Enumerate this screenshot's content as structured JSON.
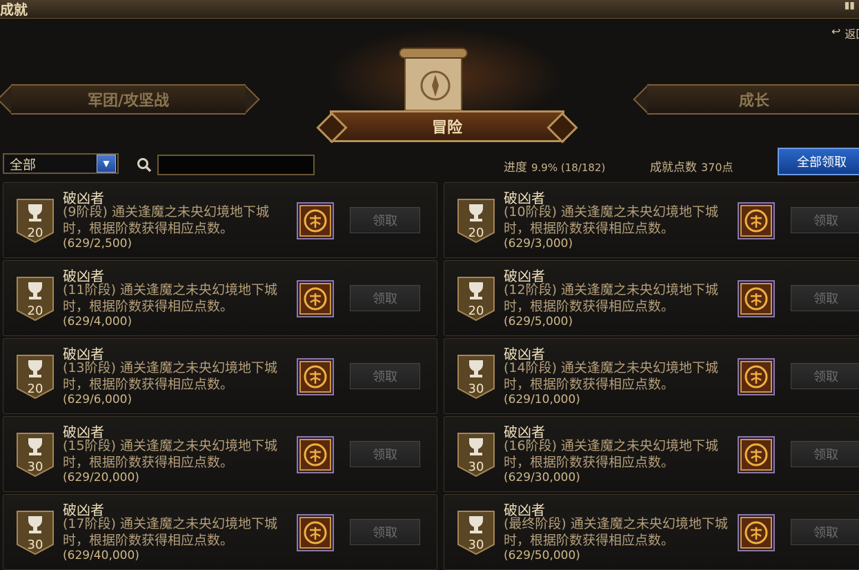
{
  "window": {
    "title": "成就"
  },
  "header": {
    "return_label": "返回"
  },
  "categories": {
    "left": "军团/攻坚战",
    "active": "冒险",
    "right": "成长"
  },
  "filter": {
    "selected": "全部",
    "search_placeholder": ""
  },
  "stats": {
    "progress_label": "进度",
    "progress_value": "9.9% (18/182)",
    "points_label": "成就点数",
    "points_value": "370点"
  },
  "claim_all_label": "全部领取",
  "colors": {
    "accent_blue": "#1f4fa8",
    "gold": "#b89258",
    "bg": "#141210"
  },
  "achievements": [
    {
      "title": "破凶者",
      "points": "20",
      "desc": "(9阶段) 通关逢魔之未央幻境地下城时，根据阶数获得相应点数。",
      "progress": "(629/2,500)",
      "claim": "领取"
    },
    {
      "title": "破凶者",
      "points": "20",
      "desc": "(10阶段) 通关逢魔之未央幻境地下城时，根据阶数获得相应点数。",
      "progress": "(629/3,000)",
      "claim": "领取"
    },
    {
      "title": "破凶者",
      "points": "20",
      "desc": "(11阶段) 通关逢魔之未央幻境地下城时，根据阶数获得相应点数。",
      "progress": "(629/4,000)",
      "claim": "领取"
    },
    {
      "title": "破凶者",
      "points": "20",
      "desc": "(12阶段) 通关逢魔之未央幻境地下城时，根据阶数获得相应点数。",
      "progress": "(629/5,000)",
      "claim": "领取"
    },
    {
      "title": "破凶者",
      "points": "20",
      "desc": "(13阶段) 通关逢魔之未央幻境地下城时，根据阶数获得相应点数。",
      "progress": "(629/6,000)",
      "claim": "领取"
    },
    {
      "title": "破凶者",
      "points": "30",
      "desc": "(14阶段) 通关逢魔之未央幻境地下城时，根据阶数获得相应点数。",
      "progress": "(629/10,000)",
      "claim": "领取"
    },
    {
      "title": "破凶者",
      "points": "30",
      "desc": "(15阶段) 通关逢魔之未央幻境地下城时，根据阶数获得相应点数。",
      "progress": "(629/20,000)",
      "claim": "领取"
    },
    {
      "title": "破凶者",
      "points": "30",
      "desc": "(16阶段) 通关逢魔之未央幻境地下城时，根据阶数获得相应点数。",
      "progress": "(629/30,000)",
      "claim": "领取"
    },
    {
      "title": "破凶者",
      "points": "30",
      "desc": "(17阶段) 通关逢魔之未央幻境地下城时，根据阶数获得相应点数。",
      "progress": "(629/40,000)",
      "claim": "领取"
    },
    {
      "title": "破凶者",
      "points": "30",
      "desc": "(最终阶段) 通关逢魔之未央幻境地下城时，根据阶数获得相应点数。",
      "progress": "(629/50,000)",
      "claim": "领取"
    }
  ]
}
